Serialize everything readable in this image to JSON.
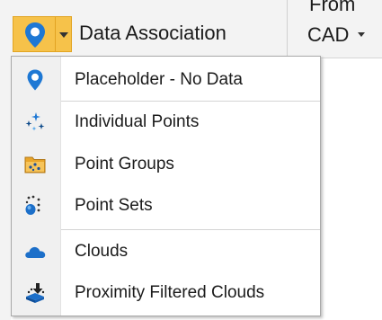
{
  "ribbon": {
    "data_association_label": "Data Association",
    "from_line1": "From",
    "from_line2": "CAD",
    "accent_color": "#f6c24a",
    "icon": "location-pin-icon"
  },
  "menu": {
    "items": [
      {
        "label": "Placeholder - No Data",
        "icon": "location-pin-icon"
      },
      {
        "label": "Individual Points",
        "icon": "sparkle-points-icon"
      },
      {
        "label": "Point Groups",
        "icon": "point-groups-icon"
      },
      {
        "label": "Point Sets",
        "icon": "point-sets-icon"
      },
      {
        "label": "Clouds",
        "icon": "cloud-icon"
      },
      {
        "label": "Proximity Filtered Clouds",
        "icon": "proximity-filter-icon"
      }
    ]
  },
  "colors": {
    "pin_blue": "#1e78d4",
    "cloud_blue": "#1c6fc9",
    "menu_border": "#a9a9a9",
    "gutter": "#f0f0f0"
  }
}
